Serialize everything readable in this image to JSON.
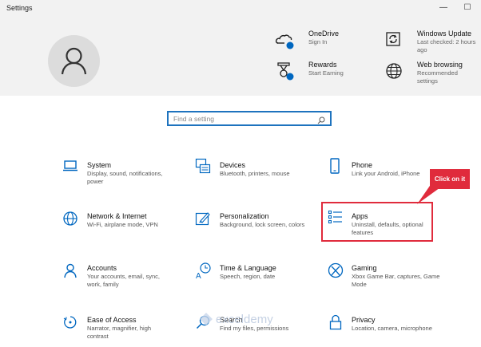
{
  "window": {
    "title": "Settings",
    "minimize": "—",
    "maximize": "☐"
  },
  "header": {
    "items": [
      {
        "title": "OneDrive",
        "subtitle": "Sign In"
      },
      {
        "title": "Rewards",
        "subtitle": "Start Earning"
      },
      {
        "title": "Windows Update",
        "subtitle": "Last checked: 2 hours ago"
      },
      {
        "title": "Web browsing",
        "subtitle": "Recommended settings"
      }
    ]
  },
  "search": {
    "placeholder": "Find a setting"
  },
  "categories": [
    {
      "title": "System",
      "desc": "Display, sound, notifications, power"
    },
    {
      "title": "Devices",
      "desc": "Bluetooth, printers, mouse"
    },
    {
      "title": "Phone",
      "desc": "Link your Android, iPhone"
    },
    {
      "title": "Network & Internet",
      "desc": "Wi-Fi, airplane mode, VPN"
    },
    {
      "title": "Personalization",
      "desc": "Background, lock screen, colors"
    },
    {
      "title": "Apps",
      "desc": "Uninstall, defaults, optional features"
    },
    {
      "title": "Accounts",
      "desc": "Your accounts, email, sync, work, family"
    },
    {
      "title": "Time & Language",
      "desc": "Speech, region, date"
    },
    {
      "title": "Gaming",
      "desc": "Xbox Game Bar, captures, Game Mode"
    },
    {
      "title": "Ease of Access",
      "desc": "Narrator, magnifier, high contrast"
    },
    {
      "title": "Search",
      "desc": "Find my files, permissions"
    },
    {
      "title": "Privacy",
      "desc": "Location, camera, microphone"
    }
  ],
  "annotation": {
    "callout": "Click on it"
  },
  "watermark": "exceldemy",
  "colors": {
    "accent": "#0067c0",
    "callout": "#e02b3c",
    "header_bg": "#f2f2f2"
  }
}
